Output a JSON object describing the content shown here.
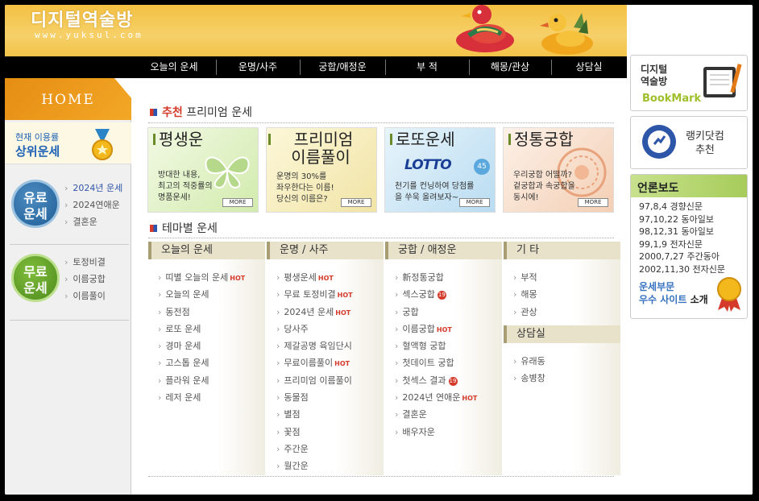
{
  "header": {
    "logo": "디지털역술방",
    "url": "www.yuksul.com"
  },
  "nav": [
    "오늘의 운세",
    "운명/사주",
    "궁합/애정운",
    "부 적",
    "해몽/관상",
    "상담실"
  ],
  "left": {
    "home": "HOME",
    "top_fortune": {
      "line1": "현재 이용률",
      "line2": "상위운세"
    },
    "paid": {
      "circle": [
        "유료",
        "운세"
      ],
      "links": [
        "2024년 운세",
        "2024연애운",
        "결혼운"
      ]
    },
    "free": {
      "circle": [
        "무료",
        "운세"
      ],
      "links": [
        "토정비결",
        "이름궁합",
        "이름풀이"
      ]
    }
  },
  "premium": {
    "title_red": "추천",
    "title": "프리미엄 운세",
    "more": "MORE",
    "cards": [
      {
        "title": "평생운",
        "desc": [
          "방대한 내용,",
          "최고의 적중률의",
          "명품운세!"
        ],
        "bg": "#dcefb9"
      },
      {
        "title": "프리미엄\n이름풀이",
        "desc": [
          "운명의 30%를",
          "좌우한다는 이름!",
          "당신의 이름은?"
        ],
        "bg": "#f7efc0"
      },
      {
        "title": "로또운세",
        "logo": "LOTTO",
        "logo_num": "45",
        "desc": [
          "천기를 컨닝하여 당첨률",
          "을 쑤욱 올려보자~"
        ],
        "bg": "#c9e4f4"
      },
      {
        "title": "정통궁합",
        "desc": [
          "우리궁합 어떨까?",
          "겉궁합과 속궁합을",
          "동시에!"
        ],
        "bg": "#f9e0cf"
      }
    ]
  },
  "theme": {
    "title": "테마별 운세",
    "columns": [
      {
        "header": "오늘의 운세",
        "items": [
          {
            "t": "띠별 오늘의 운세",
            "hot": true
          },
          {
            "t": "오늘의 운세"
          },
          {
            "t": "동전점"
          },
          {
            "t": "로또 운세"
          },
          {
            "t": "경마 운세"
          },
          {
            "t": "고스톱 운세"
          },
          {
            "t": "플라워 운세"
          },
          {
            "t": "레저 운세"
          }
        ]
      },
      {
        "header": "운명 / 사주",
        "items": [
          {
            "t": "평생운세",
            "hot": true
          },
          {
            "t": "무료 토정비결",
            "hot": true
          },
          {
            "t": "2024년 운세",
            "hot": true
          },
          {
            "t": "당사주"
          },
          {
            "t": "제갈공명 육임단시"
          },
          {
            "t": "무료이름풀이",
            "hot": true
          },
          {
            "t": "프리미엄 이름풀이"
          },
          {
            "t": "동물점"
          },
          {
            "t": "별점"
          },
          {
            "t": "꽃점"
          },
          {
            "t": "주간운"
          },
          {
            "t": "월간운"
          }
        ]
      },
      {
        "header": "궁합 / 애정운",
        "items": [
          {
            "t": "新정통궁합"
          },
          {
            "t": "섹스궁합",
            "badge": "19"
          },
          {
            "t": "궁합"
          },
          {
            "t": "이름궁합",
            "hot": true
          },
          {
            "t": "혈액형 궁합"
          },
          {
            "t": "첫데이트 궁합"
          },
          {
            "t": "첫섹스 결과",
            "badge": "19"
          },
          {
            "t": "2024년 연애운",
            "hot": true
          },
          {
            "t": "결혼운"
          },
          {
            "t": "배우자운"
          }
        ]
      },
      {
        "header": "기    타",
        "items": [
          {
            "t": "부적"
          },
          {
            "t": "해몽"
          },
          {
            "t": "관상"
          }
        ],
        "header2": "상담실",
        "items2": [
          {
            "t": "유래동"
          },
          {
            "t": "송병창"
          }
        ]
      }
    ],
    "hot_label": "HOT"
  },
  "right": {
    "bookmark": {
      "line1": "디지털",
      "line2": "역술방",
      "label": "BookMark"
    },
    "ranking": {
      "line1": "랭키닷컴",
      "line2": "추천"
    },
    "press": {
      "title": "언론보도",
      "items": [
        "97,8,4 경향신문",
        "97,10,22 동아일보",
        "98,12,31 동아일보",
        "99,1,9 전자신문",
        "2000,7,27 주간동아",
        "2002,11,30 전자신문"
      ],
      "award1": "운세부문",
      "award2_a": "우수 사이트",
      "award2_b": " 소개"
    }
  }
}
